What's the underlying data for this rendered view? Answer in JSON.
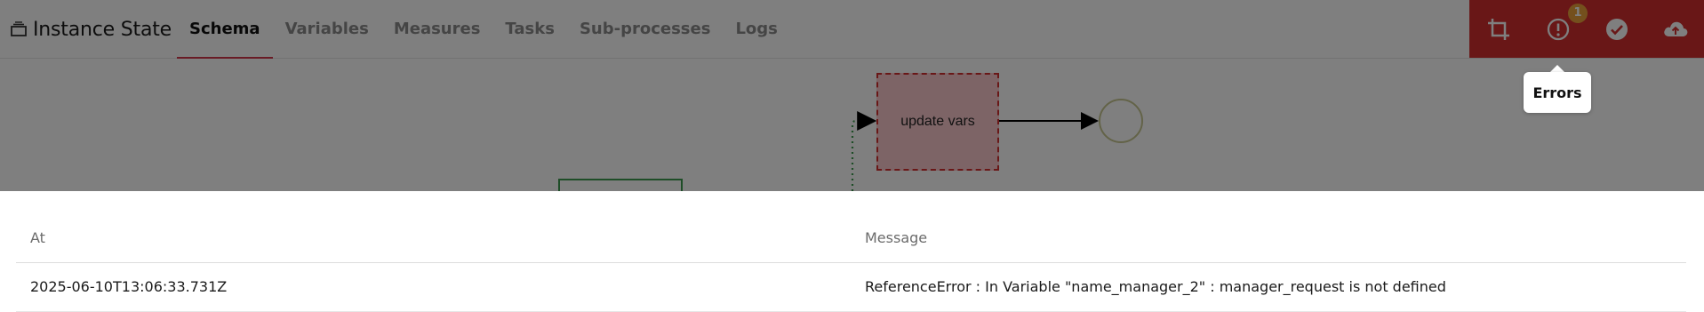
{
  "header": {
    "title": "Instance State",
    "title_icon": "stack-icon",
    "tabs": [
      {
        "label": "Schema",
        "active": true
      },
      {
        "label": "Variables",
        "active": false
      },
      {
        "label": "Measures",
        "active": false
      },
      {
        "label": "Tasks",
        "active": false
      },
      {
        "label": "Sub-processes",
        "active": false
      },
      {
        "label": "Logs",
        "active": false
      }
    ],
    "actions": [
      {
        "name": "crop-icon"
      },
      {
        "name": "errors-icon",
        "badge": "1"
      },
      {
        "name": "check-circle-icon"
      },
      {
        "name": "cloud-upload-icon"
      }
    ],
    "tooltip": "Errors",
    "colors": {
      "action_bar": "#d32f2f",
      "badge": "#e8a13a",
      "active_tab_underline": "#d3374a"
    }
  },
  "schema": {
    "nodes": [
      {
        "label": "update vars",
        "type": "task",
        "status": "error"
      },
      {
        "type": "end-event"
      },
      {
        "type": "task",
        "status": "completed"
      }
    ]
  },
  "errors_panel": {
    "columns": [
      "At",
      "Message"
    ],
    "rows": [
      {
        "at": "2025-06-10T13:06:33.731Z",
        "message": "ReferenceError : In Variable \"name_manager_2\" : manager_request is not defined"
      }
    ]
  }
}
